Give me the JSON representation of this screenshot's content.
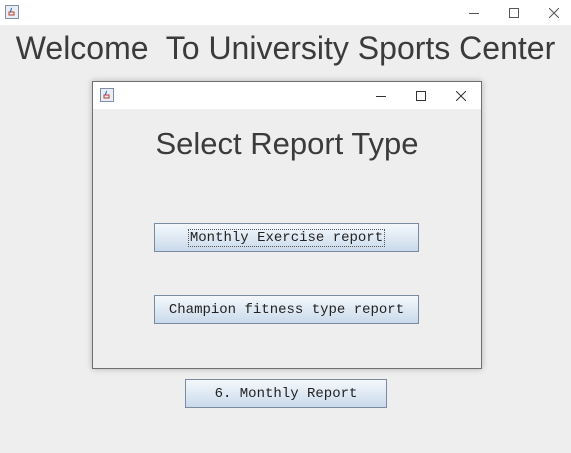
{
  "main_window": {
    "headline": "Welcome  To University Sports Center",
    "monthly_report_button": "6. Monthly Report"
  },
  "dialog": {
    "heading": "Select Report Type",
    "buttons": [
      {
        "label": "Monthly Exercise report",
        "focused": true
      },
      {
        "label": "Champion fitness type report",
        "focused": false
      }
    ]
  },
  "icons": {
    "app_icon": "java-cup-icon",
    "minimize": "minimize-icon",
    "maximize": "maximize-icon",
    "close": "close-icon"
  }
}
